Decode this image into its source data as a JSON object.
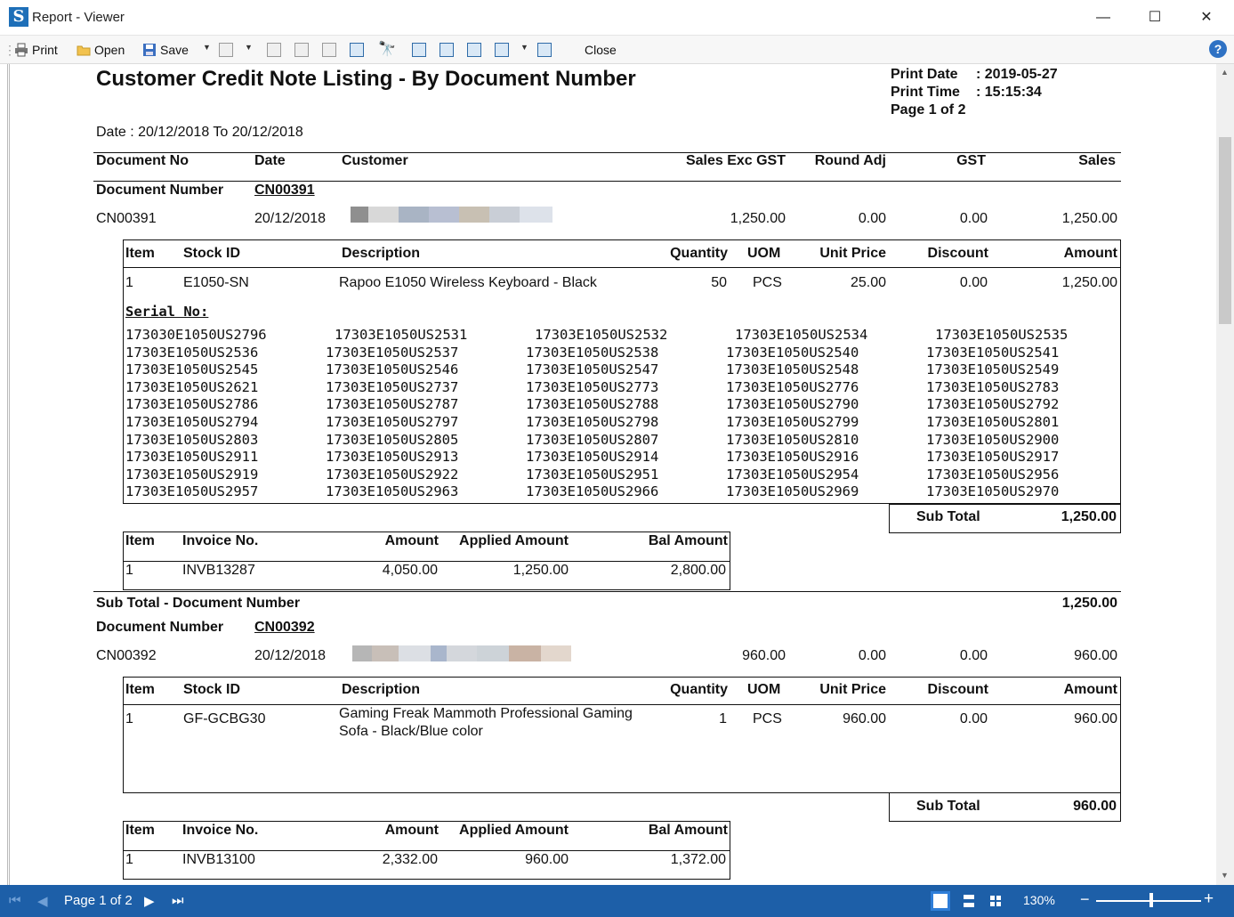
{
  "window": {
    "title": "Report - Viewer",
    "minimize": "—",
    "maximize": "☐",
    "close": "✕"
  },
  "toolbar": {
    "print": "Print",
    "open": "Open",
    "save": "Save",
    "close": "Close",
    "help": "?"
  },
  "report": {
    "title": "Customer Credit Note Listing - By Document Number",
    "print_date_label": "Print Date",
    "print_date": ": 2019-05-27",
    "print_time_label": "Print Time",
    "print_time": ": 15:15:34",
    "page": "Page 1 of 2",
    "date_range": "Date : 20/12/2018 To 20/12/2018",
    "columns": [
      "Document No",
      "Date",
      "Customer",
      "Sales Exc GST",
      "Round Adj",
      "GST",
      "Sales"
    ],
    "item_columns": [
      "Item",
      "Stock ID",
      "Description",
      "Quantity",
      "UOM",
      "Unit Price",
      "Discount",
      "Amount"
    ],
    "invoice_columns": [
      "Item",
      "Invoice No.",
      "Amount",
      "Applied Amount",
      "Bal Amount"
    ],
    "doc_number_label": "Document Number",
    "serial_label": "Serial No:",
    "sub_total_label": "Sub Total",
    "sub_total_doc_label": "Sub Total - Document Number",
    "groups": [
      {
        "group_no": "CN00391",
        "doc": {
          "no": "CN00391",
          "date": "20/12/2018",
          "sales_exc_gst": "1,250.00",
          "round_adj": "0.00",
          "gst": "0.00",
          "sales": "1,250.00"
        },
        "items": [
          {
            "item": "1",
            "stock_id": "E1050-SN",
            "description": "Rapoo E1050 Wireless Keyboard - Black",
            "quantity": "50",
            "uom": "PCS",
            "unit_price": "25.00",
            "discount": "0.00",
            "amount": "1,250.00"
          }
        ],
        "serials": [
          [
            "173030E1050US2796",
            "17303E1050US2531",
            "17303E1050US2532",
            "17303E1050US2534",
            "17303E1050US2535"
          ],
          [
            "17303E1050US2536",
            "17303E1050US2537",
            "17303E1050US2538",
            "17303E1050US2540",
            "17303E1050US2541"
          ],
          [
            "17303E1050US2545",
            "17303E1050US2546",
            "17303E1050US2547",
            "17303E1050US2548",
            "17303E1050US2549"
          ],
          [
            "17303E1050US2621",
            "17303E1050US2737",
            "17303E1050US2773",
            "17303E1050US2776",
            "17303E1050US2783"
          ],
          [
            "17303E1050US2786",
            "17303E1050US2787",
            "17303E1050US2788",
            "17303E1050US2790",
            "17303E1050US2792"
          ],
          [
            "17303E1050US2794",
            "17303E1050US2797",
            "17303E1050US2798",
            "17303E1050US2799",
            "17303E1050US2801"
          ],
          [
            "17303E1050US2803",
            "17303E1050US2805",
            "17303E1050US2807",
            "17303E1050US2810",
            "17303E1050US2900"
          ],
          [
            "17303E1050US2911",
            "17303E1050US2913",
            "17303E1050US2914",
            "17303E1050US2916",
            "17303E1050US2917"
          ],
          [
            "17303E1050US2919",
            "17303E1050US2922",
            "17303E1050US2951",
            "17303E1050US2954",
            "17303E1050US2956"
          ],
          [
            "17303E1050US2957",
            "17303E1050US2963",
            "17303E1050US2966",
            "17303E1050US2969",
            "17303E1050US2970"
          ]
        ],
        "sub_total": "1,250.00",
        "invoices": [
          {
            "item": "1",
            "invoice_no": "INVB13287",
            "amount": "4,050.00",
            "applied": "1,250.00",
            "bal": "2,800.00"
          }
        ],
        "sub_total_doc": "1,250.00"
      },
      {
        "group_no": "CN00392",
        "doc": {
          "no": "CN00392",
          "date": "20/12/2018",
          "sales_exc_gst": "960.00",
          "round_adj": "0.00",
          "gst": "0.00",
          "sales": "960.00"
        },
        "items": [
          {
            "item": "1",
            "stock_id": "GF-GCBG30",
            "description_line1": "Gaming Freak Mammoth Professional Gaming",
            "description_line2": "Sofa - Black/Blue color",
            "quantity": "1",
            "uom": "PCS",
            "unit_price": "960.00",
            "discount": "0.00",
            "amount": "960.00"
          }
        ],
        "sub_total": "960.00",
        "invoices": [
          {
            "item": "1",
            "invoice_no": "INVB13100",
            "amount": "2,332.00",
            "applied": "960.00",
            "bal": "1,372.00"
          }
        ]
      }
    ]
  },
  "statusbar": {
    "page_label": "Page 1 of 2",
    "zoom": "130%",
    "zoom_out": "−",
    "zoom_in": "+"
  },
  "colors": {
    "statusbar": "#1d5fa8",
    "logo": "#1e6fb8"
  }
}
